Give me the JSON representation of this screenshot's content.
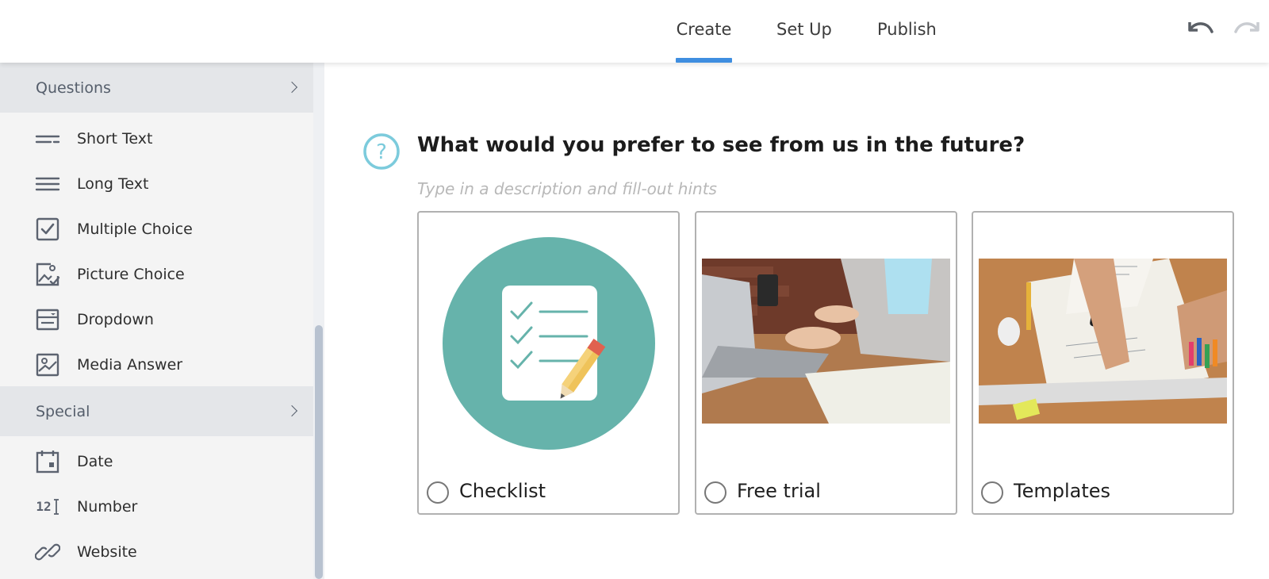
{
  "header": {
    "tabs": [
      {
        "label": "Create",
        "active": true
      },
      {
        "label": "Set Up",
        "active": false
      },
      {
        "label": "Publish",
        "active": false
      }
    ],
    "undo_icon": "undo-icon",
    "redo_icon": "redo-icon",
    "accent_color": "#3f8ee0"
  },
  "sidebar": {
    "sections": [
      {
        "title": "Questions",
        "items": [
          {
            "label": "Short Text",
            "icon": "short-text-icon"
          },
          {
            "label": "Long Text",
            "icon": "long-text-icon"
          },
          {
            "label": "Multiple Choice",
            "icon": "checkbox-icon"
          },
          {
            "label": "Picture Choice",
            "icon": "picture-choice-icon"
          },
          {
            "label": "Dropdown",
            "icon": "dropdown-icon"
          },
          {
            "label": "Media Answer",
            "icon": "media-answer-icon"
          }
        ]
      },
      {
        "title": "Special",
        "items": [
          {
            "label": "Date",
            "icon": "calendar-icon"
          },
          {
            "label": "Number",
            "icon": "number-icon",
            "glyph": "12"
          },
          {
            "label": "Website",
            "icon": "link-icon"
          }
        ]
      }
    ]
  },
  "question": {
    "icon": "question-mark-icon",
    "title": "What would you prefer to see from us in the future?",
    "description_placeholder": "Type in a description and fill-out hints",
    "choices": [
      {
        "label": "Checklist",
        "image": "checklist-illustration",
        "selected": false
      },
      {
        "label": "Free trial",
        "image": "laptop-photo",
        "selected": false
      },
      {
        "label": "Templates",
        "image": "desk-workspace-photo",
        "selected": false
      }
    ]
  },
  "colors": {
    "icon_teal": "#7ccbdc",
    "checklist_teal": "#66b3ab"
  }
}
